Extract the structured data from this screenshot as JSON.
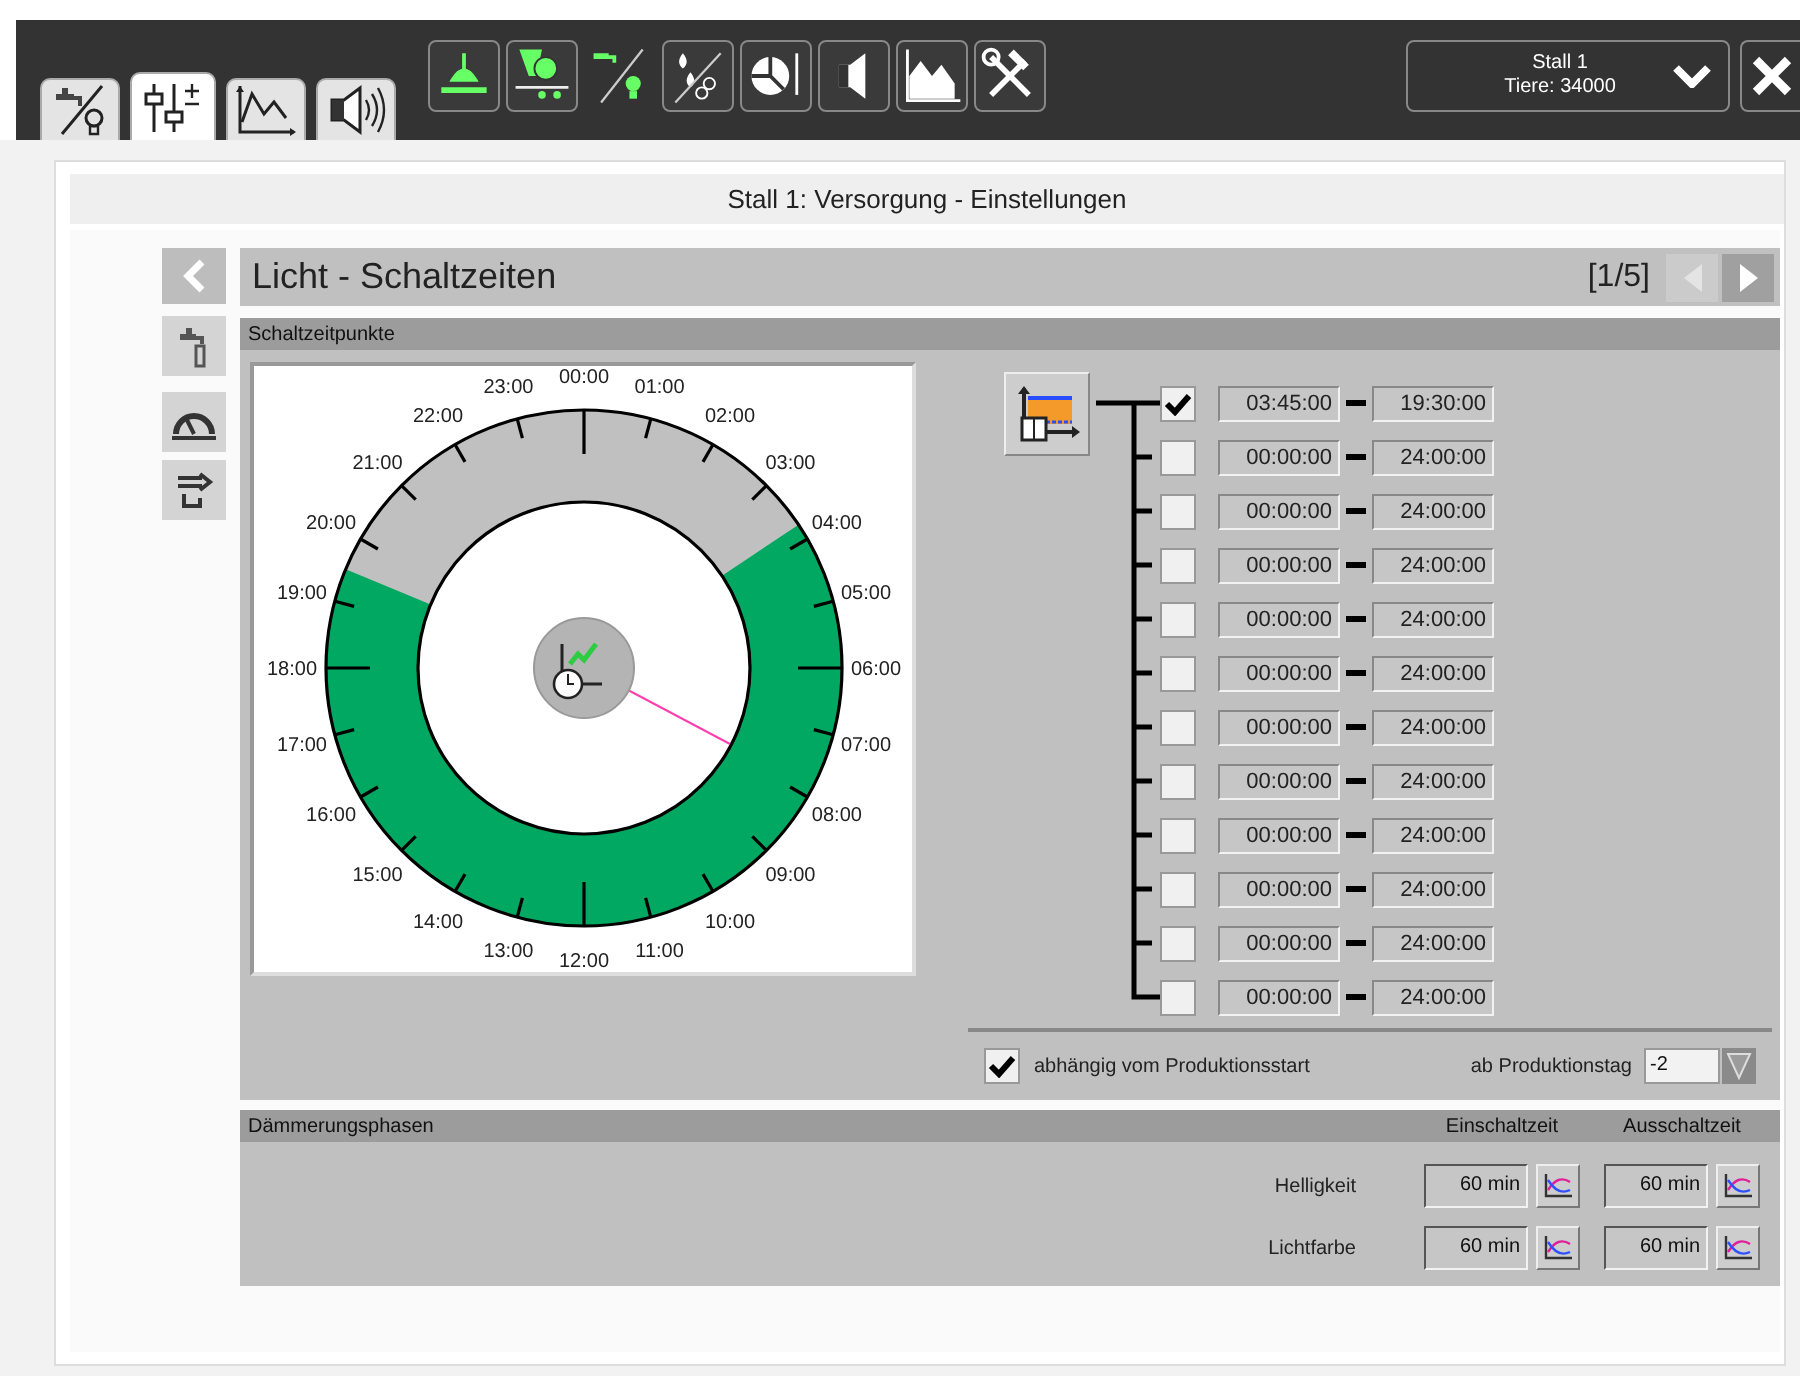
{
  "tabs": [
    {
      "kind": "supply",
      "selected": false
    },
    {
      "kind": "settings",
      "selected": true
    },
    {
      "kind": "chart",
      "selected": false
    },
    {
      "kind": "sound",
      "selected": false
    }
  ],
  "stall_selector": {
    "name": "Stall 1",
    "animals": "Tiere: 34000"
  },
  "page_title": "Stall 1: Versorgung - Einstellungen",
  "panel": {
    "title": "Licht - Schaltzeiten",
    "pager": "[1/5]",
    "pager_buttons": [
      {
        "kind": "prev",
        "disabled": true
      },
      {
        "kind": "next",
        "disabled": false
      }
    ]
  },
  "schedule": {
    "title": "Schaltzeitpunkte",
    "clock": {
      "right_hour_labels": [
        "00:00",
        "01:00",
        "02:00",
        "03:00",
        "04:00",
        "05:00",
        "06:00",
        "07:00",
        "08:00",
        "09:00",
        "10:00",
        "11:00",
        "12:00"
      ],
      "left_hour_labels": [
        "23:00",
        "22:00",
        "21:00",
        "20:00",
        "19:00",
        "18:00",
        "17:00",
        "16:00",
        "15:00",
        "14:00",
        "13:00"
      ]
    },
    "entries": [
      {
        "checked": true,
        "start": "03:45:00",
        "end": "19:30:00"
      },
      {
        "checked": false,
        "start": "00:00:00",
        "end": "24:00:00"
      },
      {
        "checked": false,
        "start": "00:00:00",
        "end": "24:00:00"
      },
      {
        "checked": false,
        "start": "00:00:00",
        "end": "24:00:00"
      },
      {
        "checked": false,
        "start": "00:00:00",
        "end": "24:00:00"
      },
      {
        "checked": false,
        "start": "00:00:00",
        "end": "24:00:00"
      },
      {
        "checked": false,
        "start": "00:00:00",
        "end": "24:00:00"
      },
      {
        "checked": false,
        "start": "00:00:00",
        "end": "24:00:00"
      },
      {
        "checked": false,
        "start": "00:00:00",
        "end": "24:00:00"
      },
      {
        "checked": false,
        "start": "00:00:00",
        "end": "24:00:00"
      },
      {
        "checked": false,
        "start": "00:00:00",
        "end": "24:00:00"
      },
      {
        "checked": false,
        "start": "00:00:00",
        "end": "24:00:00"
      }
    ],
    "production_start": {
      "label": "abhängig vom Produktionsstart",
      "checked": true
    },
    "production_day": {
      "label": "ab Produktionstag",
      "value": "-2"
    }
  },
  "twilight": {
    "title": "Dämmerungsphasen",
    "columns": [
      "Einschaltzeit",
      "Ausschaltzeit"
    ],
    "rows": [
      {
        "label": "Helligkeit",
        "on": "60 min",
        "off": "60 min"
      },
      {
        "label": "Lichtfarbe",
        "on": "60 min",
        "off": "60 min"
      }
    ]
  }
}
